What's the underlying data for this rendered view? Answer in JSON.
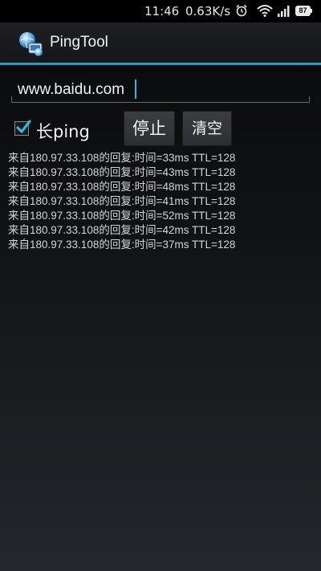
{
  "status_bar": {
    "time": "11:46",
    "network_speed": "0.63K/s",
    "battery_level": "87",
    "icons": [
      "alarm-icon",
      "wifi-icon",
      "signal-icon",
      "battery-icon"
    ]
  },
  "action_bar": {
    "title": "PingTool",
    "icon": "app-logo-icon"
  },
  "host_input": {
    "value": "www.baidu.com"
  },
  "controls": {
    "long_ping_label": "长ping",
    "long_ping_checked": true,
    "stop_label": "停止",
    "clear_label": "清空"
  },
  "results": [
    "来自180.97.33.108的回复:时间=33ms TTL=128",
    "来自180.97.33.108的回复:时间=43ms TTL=128",
    "来自180.97.33.108的回复:时间=48ms TTL=128",
    "来自180.97.33.108的回复:时间=41ms TTL=128",
    "来自180.97.33.108的回复:时间=52ms TTL=128",
    "来自180.97.33.108的回复:时间=42ms TTL=128",
    "来自180.97.33.108的回复:时间=37ms TTL=128"
  ],
  "colors": {
    "accent": "#33b5e5",
    "text": "#f2f2f2",
    "result_text": "#d4d4d4"
  }
}
